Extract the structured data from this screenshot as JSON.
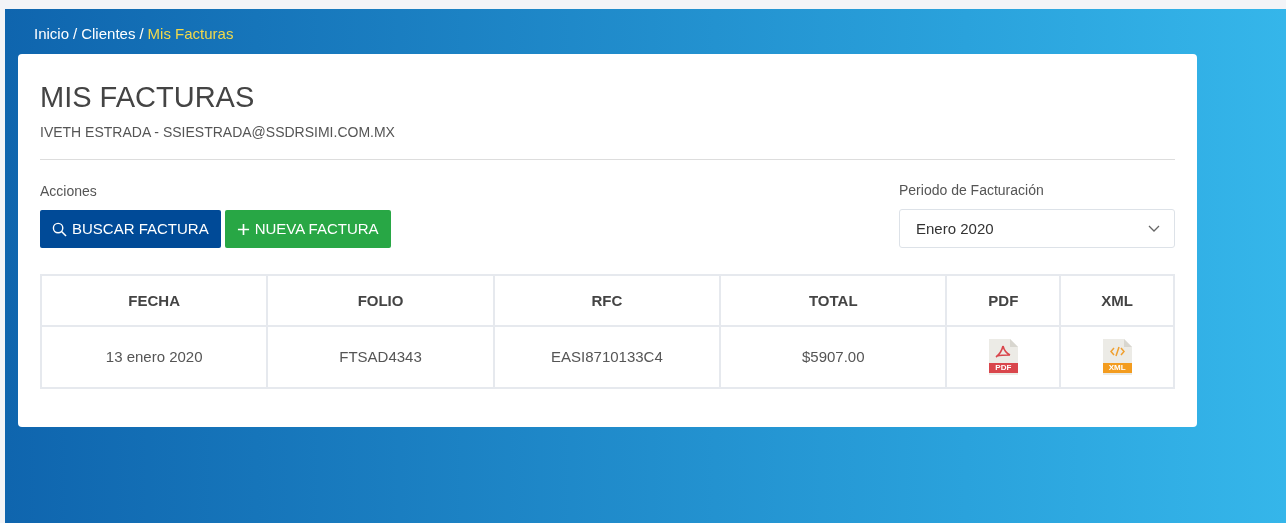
{
  "breadcrumb": [
    {
      "label": "Inicio",
      "selected": false
    },
    {
      "separator": "/",
      "label": "Clientes",
      "selected": false
    },
    {
      "separator": "/",
      "label": "Mis Facturas",
      "selected": true
    }
  ],
  "title": "MIS FACTURAS",
  "subtitle": "IVETH ESTRADA - SSIESTRADA@SSDRSIMI.COM.MX",
  "actions_label": "Acciones",
  "buttons": [
    {
      "label": "BUSCAR FACTURA",
      "kind": "search"
    },
    {
      "label": "NUEVA FACTURA",
      "kind": "add"
    }
  ],
  "period": {
    "label": "Periodo de Facturación",
    "value": "Enero 2020"
  },
  "table": {
    "columns": [
      "FECHA",
      "FOLIO",
      "RFC",
      "TOTAL",
      "PDF",
      "XML"
    ],
    "rows": [
      {
        "cells": [
          "13 enero 2020",
          "FTSAD4343",
          "EASI8710133C4",
          "$5907.00"
        ],
        "files": [
          {
            "kind": "pdf",
            "label": "PDF"
          },
          {
            "kind": "xml",
            "label": "XML"
          }
        ]
      }
    ]
  }
}
